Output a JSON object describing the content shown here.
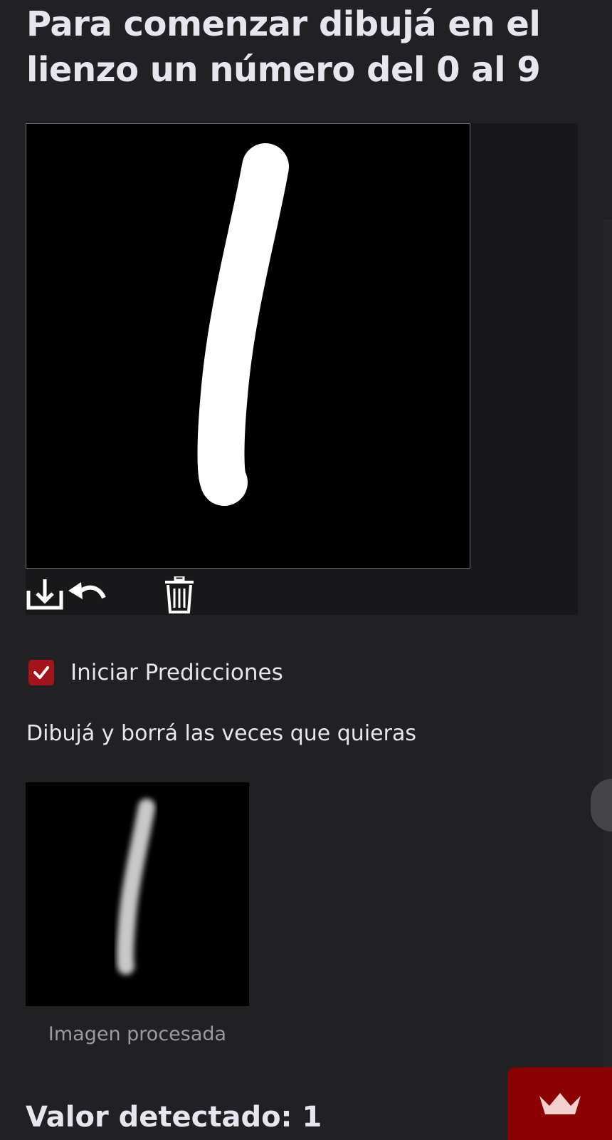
{
  "header": {
    "title": "Para comenzar dibujá en el lienzo un número del 0 al 9"
  },
  "canvas": {
    "toolbar": {
      "download_icon": "download-icon",
      "undo_icon": "undo-icon",
      "trash_icon": "trash-icon"
    }
  },
  "controls": {
    "checkbox_label": "Iniciar Predicciones",
    "checkbox_checked": true
  },
  "helper_text": "Dibujá y borrá las veces que quieras",
  "processed": {
    "caption": "Imagen procesada"
  },
  "result": {
    "label": "Valor detectado: 1"
  },
  "badge": {
    "icon": "crown-icon"
  },
  "colors": {
    "background": "#212123",
    "text": "#e6e6ef",
    "accent": "#a3141d",
    "badge": "#8b0000"
  }
}
